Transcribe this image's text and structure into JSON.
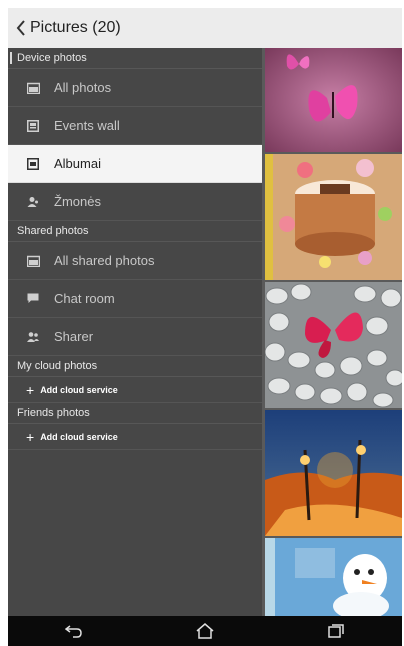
{
  "header": {
    "back_icon": "chevron-left-icon",
    "title": "Pictures (20)"
  },
  "drawer": {
    "device": {
      "label": "Device photos",
      "items": [
        {
          "label": "All photos",
          "icon": "photos-icon"
        },
        {
          "label": "Events wall",
          "icon": "events-wall-icon"
        },
        {
          "label": "Albumai",
          "icon": "album-icon",
          "selected": true
        },
        {
          "label": "Žmonės",
          "icon": "people-icon"
        }
      ]
    },
    "shared": {
      "label": "Shared photos",
      "items": [
        {
          "label": "All shared photos",
          "icon": "shared-photos-icon"
        },
        {
          "label": "Chat room",
          "icon": "chat-icon"
        },
        {
          "label": "Sharer",
          "icon": "sharer-icon"
        }
      ]
    },
    "cloud": {
      "label": "My cloud photos",
      "add_label": "Add cloud service"
    },
    "friends": {
      "label": "Friends photos",
      "add_label": "Add cloud service"
    }
  },
  "photos": [
    "butterfly-pink-thumbnail",
    "birthday-cake-thumbnail",
    "pebbles-butterfly-thumbnail",
    "autumn-park-thumbnail",
    "snowman-thumbnail"
  ],
  "navbar": {
    "back_icon": "back-arrow-icon",
    "home_icon": "home-icon",
    "recents_icon": "recents-icon"
  },
  "colors": {
    "drawer": "#474747",
    "selected": "#f4f4f4",
    "header": "#ececec"
  }
}
